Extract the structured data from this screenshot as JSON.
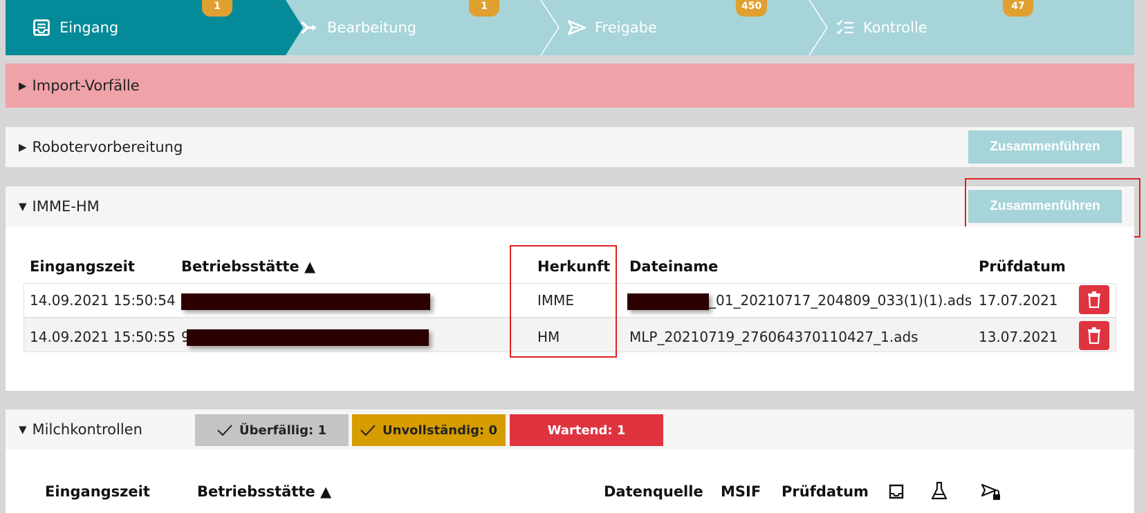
{
  "stepper": {
    "steps": [
      {
        "label": "Eingang",
        "badge": "1",
        "icon": "inbox-icon"
      },
      {
        "label": "Bearbeitung",
        "badge": "1",
        "icon": "branch-icon"
      },
      {
        "label": "Freigabe",
        "badge": "450",
        "icon": "send-icon"
      },
      {
        "label": "Kontrolle",
        "badge": "47",
        "icon": "checklist-icon"
      }
    ]
  },
  "sections": {
    "import": {
      "label": "Import-Vorfälle",
      "expanded": false
    },
    "robot": {
      "label": "Robotervorbereitung",
      "expanded": false,
      "merge_label": "Zusammenführen"
    },
    "imme": {
      "label": "IMME-HM",
      "expanded": true,
      "merge_label": "Zusammenführen"
    },
    "milch": {
      "label": "Milchkontrollen",
      "expanded": true
    }
  },
  "imme_table": {
    "headers": {
      "eingangszeit": "Eingangszeit",
      "betrieb": "Betriebsstätte ▲",
      "herkunft": "Herkunft",
      "dateiname": "Dateiname",
      "pruefdatum": "Prüfdatum"
    },
    "rows": [
      {
        "eingangszeit": "14.09.2021 15:50:54",
        "herkunft": "IMME",
        "dateiname": "_01_20210717_204809_033(1)(1).ads",
        "pruefdatum": "17.07.2021"
      },
      {
        "eingangszeit": "14.09.2021 15:50:55",
        "betrieb_prefix": "9",
        "herkunft": "HM",
        "dateiname": "MLP_20210719_276064370110427_1.ads",
        "pruefdatum": "13.07.2021"
      }
    ]
  },
  "milch_filters": {
    "overdue": "Überfällig: 1",
    "incomplete": "Unvollständig: 0",
    "waiting": "Wartend: 1"
  },
  "milch_table": {
    "headers": {
      "eingangszeit": "Eingangszeit",
      "betrieb": "Betriebsstätte ▲",
      "datenquelle": "Datenquelle",
      "msif": "MSIF",
      "pruefdatum": "Prüfdatum"
    },
    "icons": [
      "inbox-icon",
      "flask-icon",
      "send-lock-icon"
    ]
  },
  "colors": {
    "teal_active": "#048a98",
    "teal_light": "#a6d4d8",
    "badge": "#e0a030",
    "import_bar": "#efa2a8",
    "danger": "#e03340",
    "warning": "#d69c00",
    "grey_chip": "#c4c4c4",
    "highlight": "#e02020"
  }
}
